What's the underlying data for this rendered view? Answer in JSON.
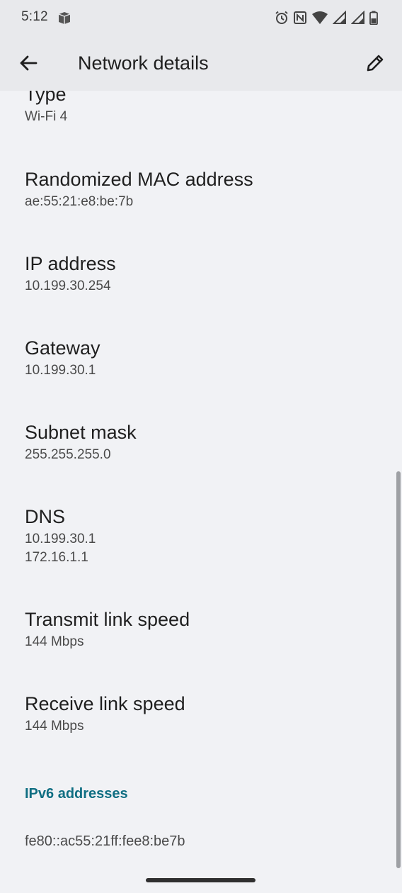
{
  "status_bar": {
    "time": "5:12"
  },
  "header": {
    "title": "Network details"
  },
  "details": [
    {
      "label": "Type",
      "value": "Wi-Fi 4"
    },
    {
      "label": "Randomized MAC address",
      "value": "ae:55:21:e8:be:7b"
    },
    {
      "label": "IP address",
      "value": "10.199.30.254"
    },
    {
      "label": "Gateway",
      "value": "10.199.30.1"
    },
    {
      "label": "Subnet mask",
      "value": "255.255.255.0"
    },
    {
      "label": "DNS",
      "value": "10.199.30.1",
      "value2": "172.16.1.1"
    },
    {
      "label": "Transmit link speed",
      "value": "144 Mbps"
    },
    {
      "label": "Receive link speed",
      "value": "144 Mbps"
    }
  ],
  "ipv6": {
    "header": "IPv6 addresses",
    "addresses": [
      "fe80::ac55:21ff:fee8:be7b"
    ]
  },
  "icons": {
    "status_left": "notification-icon",
    "status_right": [
      "alarm-icon",
      "nfc-icon",
      "wifi-icon",
      "signal-icon",
      "signal-icon",
      "battery-icon"
    ],
    "back": "arrow-back-icon",
    "edit": "pencil-icon"
  },
  "colors": {
    "accent": "#0f6e82",
    "app_bar": "#e8e9ec",
    "background": "#f1f2f5"
  }
}
